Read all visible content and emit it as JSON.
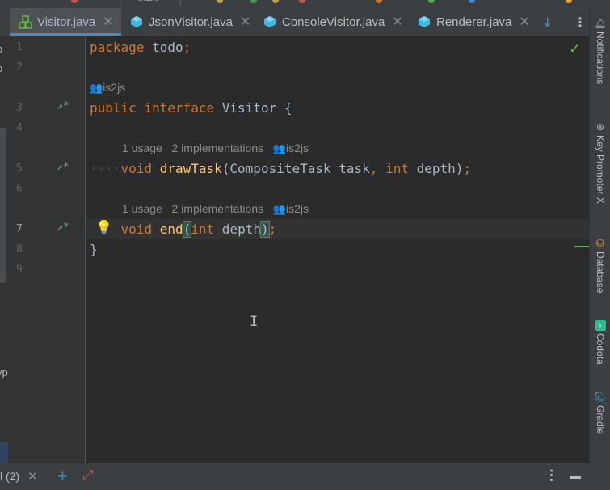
{
  "toolbar": {
    "branch_label": "main"
  },
  "tabs": [
    {
      "label": "Visitor.java",
      "icon": "interface-icon",
      "active": true
    },
    {
      "label": "JsonVisitor.java",
      "icon": "class-icon",
      "active": false
    },
    {
      "label": "ConsoleVisitor.java",
      "icon": "class-icon",
      "active": false
    },
    {
      "label": "Renderer.java",
      "icon": "class-icon",
      "active": false
    }
  ],
  "tab_tools": {
    "down_arrow": "↓",
    "more": "⋮"
  },
  "left_strip": {
    "line1": "o",
    "line2": "o",
    "line3": "yp"
  },
  "gutter": {
    "line_numbers": [
      "1",
      "2",
      "3",
      "4",
      "5",
      "6",
      "7",
      "8",
      "9"
    ],
    "impl_marker": "↗*"
  },
  "code": {
    "line1_kw": "package",
    "line1_name": "todo",
    "author_hint": "is2js",
    "line3_kw1": "public",
    "line3_kw2": "interface",
    "line3_name": "Visitor",
    "line3_brace": "{",
    "hint5_usage": "1 usage",
    "hint5_impl": "2 implementations",
    "hint5_author": "is2js",
    "line5_kw": "void",
    "line5_fn": "drawTask",
    "line5_type": "CompositeTask",
    "line5_param": "task",
    "line5_kw2": "int",
    "line5_param2": "depth",
    "hint7_usage": "1 usage",
    "hint7_impl": "2 implementations",
    "hint7_author": "is2js",
    "line7_kw": "void",
    "line7_fn": "end",
    "line7_kw2": "int",
    "line7_param": "depth",
    "line8_brace": "}"
  },
  "right_tools": [
    {
      "label": "Notifications",
      "icon": "notifications-icon"
    },
    {
      "label": "Key Promoter X",
      "icon": "key-promoter-icon"
    },
    {
      "label": "Database",
      "icon": "database-icon"
    },
    {
      "label": "Codota",
      "icon": "codota-icon"
    },
    {
      "label": "Gradle",
      "icon": "gradle-icon"
    }
  ],
  "bottom": {
    "tab_label": "l (2)"
  },
  "colors": {
    "keyword": "#cc7832",
    "function": "#ffc66d",
    "text": "#a9b7c6",
    "accent": "#4a88c7"
  }
}
